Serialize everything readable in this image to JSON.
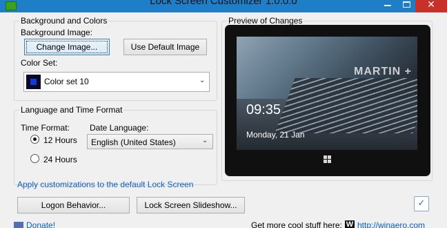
{
  "window": {
    "title": "Lock Screen Customizer 1.0.0.0",
    "close_glyph": "✕"
  },
  "background_group": {
    "legend": "Background and Colors",
    "background_image_label": "Background Image:",
    "change_image_button": "Change Image...",
    "default_image_button": "Use Default Image",
    "color_set_label": "Color Set:",
    "color_set_value": "Color set 10",
    "color_set_swatch": "#1538d8",
    "dropdown_glyph": "⌄"
  },
  "language_group": {
    "legend": "Language and Time Format",
    "time_format_label": "Time Format:",
    "option_12": "12 Hours",
    "option_24": "24 Hours",
    "selected_time_format": "12 Hours",
    "date_language_label": "Date Language:",
    "date_language_value": "English (United States)"
  },
  "preview_group": {
    "legend": "Preview of Changes",
    "screen_text": "MARTIN +",
    "clock": "09:35",
    "date": "Monday, 21 Jan"
  },
  "apply_link": "Apply customizations to the default Lock Screen",
  "logon_behavior_button": "Logon Behavior...",
  "slideshow_button": "Lock Screen Slideshow...",
  "footer": {
    "donate_link": "Donate!",
    "promo_text": "Get more cool stuff here:",
    "winaero_link": "http://winaero.com",
    "w_logo": "W"
  },
  "colors": {
    "titlebar": "#1e7ec8",
    "close_button": "#c7312a",
    "link": "#0a5fc2"
  }
}
